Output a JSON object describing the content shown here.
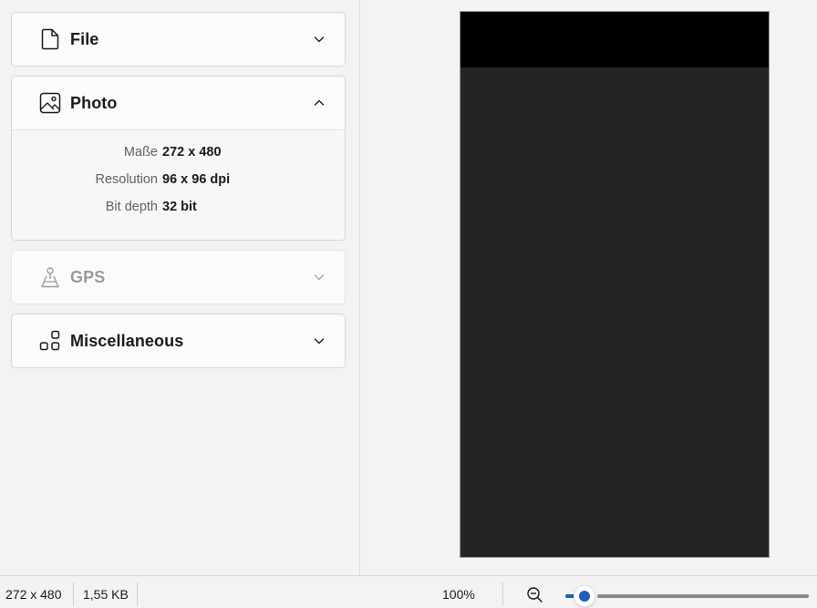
{
  "panels": {
    "file": {
      "title": "File",
      "icon": "document-icon",
      "expanded": false,
      "enabled": true
    },
    "photo": {
      "title": "Photo",
      "icon": "image-icon",
      "expanded": true,
      "enabled": true,
      "properties": [
        {
          "label": "Maße",
          "value": "272 x 480"
        },
        {
          "label": "Resolution",
          "value": "96 x 96 dpi"
        },
        {
          "label": "Bit depth",
          "value": "32 bit"
        }
      ]
    },
    "gps": {
      "title": "GPS",
      "icon": "map-pin-icon",
      "expanded": false,
      "enabled": false
    },
    "misc": {
      "title": "Miscellaneous",
      "icon": "apps-icon",
      "expanded": false,
      "enabled": true
    }
  },
  "status": {
    "dimensions": "272 x 480",
    "file_size": "1,55 KB",
    "zoom": "100%",
    "zoom_level": 0.05
  },
  "colors": {
    "accent": "#1f5fb8",
    "preview_header": "#000000",
    "preview_body": "#242424"
  }
}
